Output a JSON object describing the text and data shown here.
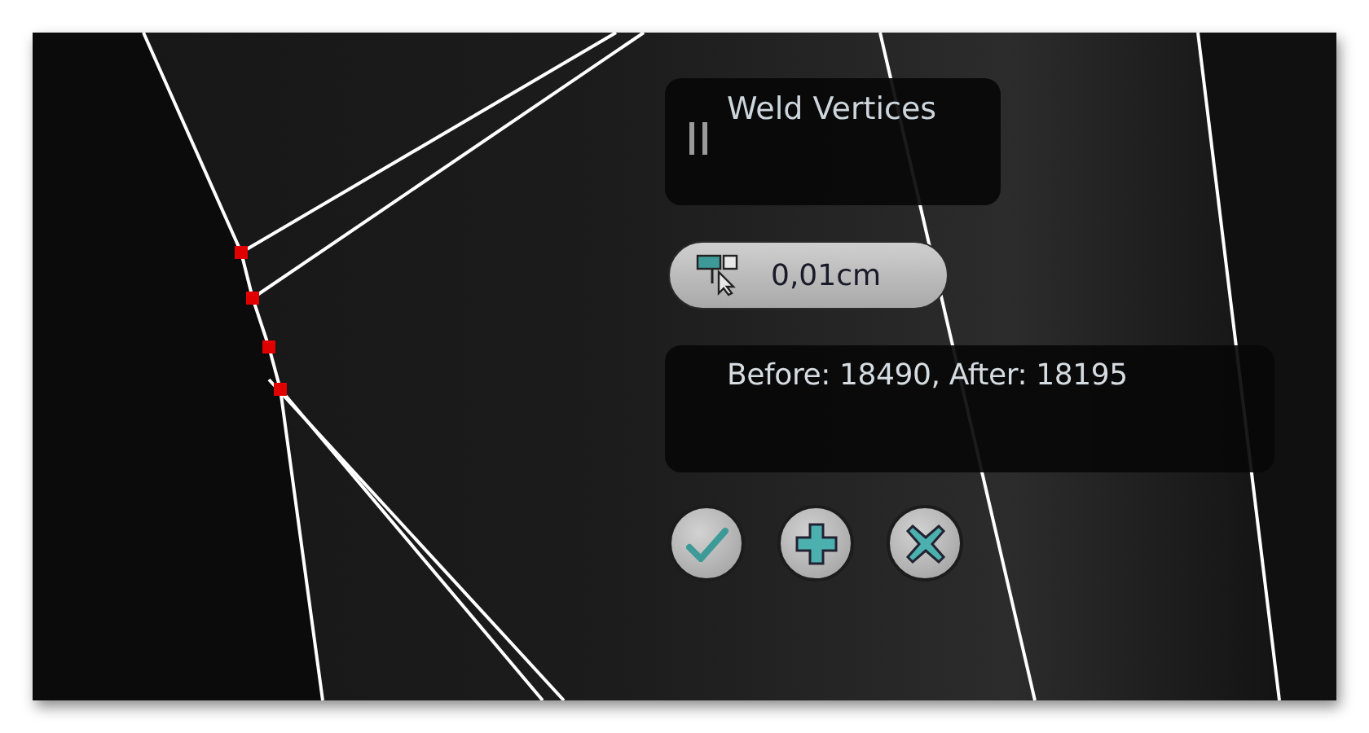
{
  "caddy": {
    "title": "Weld Vertices",
    "threshold": {
      "value": "0,01cm"
    },
    "result": "Before: 18490, After: 18195",
    "buttons": [
      {
        "kind": "ok"
      },
      {
        "kind": "apply"
      },
      {
        "kind": "cancel"
      }
    ]
  }
}
